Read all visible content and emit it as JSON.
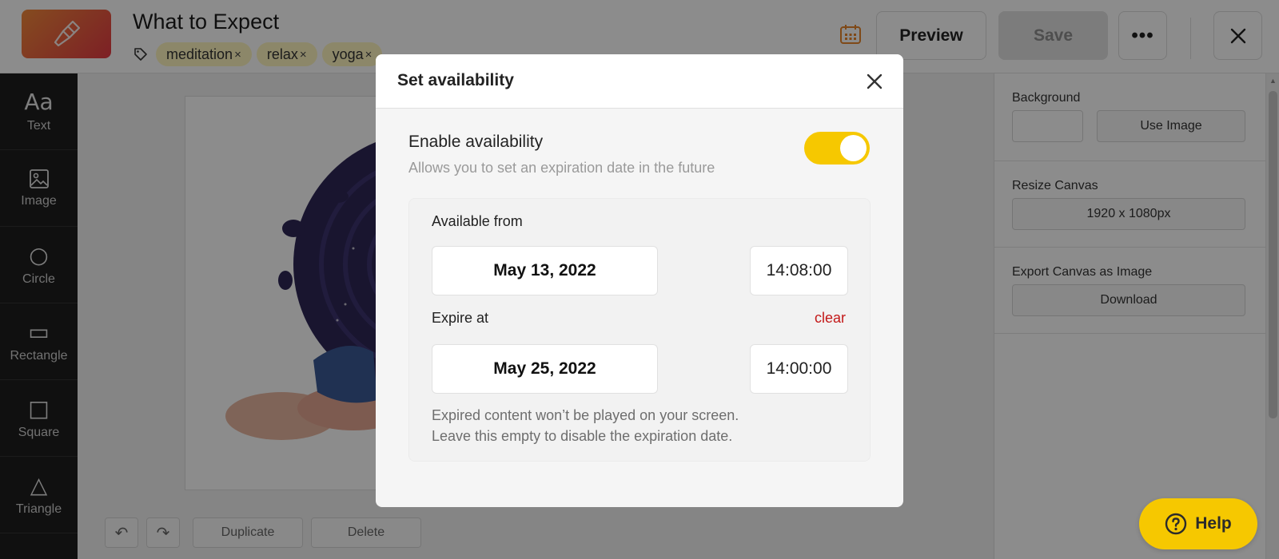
{
  "header": {
    "title": "What to Expect",
    "tags": [
      {
        "label": "meditation",
        "remove": "×"
      },
      {
        "label": "relax",
        "remove": "×"
      },
      {
        "label": "yoga",
        "remove": "×"
      }
    ],
    "preview_label": "Preview",
    "save_label": "Save",
    "more_label": "•••"
  },
  "tools": [
    {
      "label": "Text",
      "glyph": "Aa",
      "icon": "text-icon"
    },
    {
      "label": "Image",
      "glyph": "",
      "icon": "image-icon"
    },
    {
      "label": "Circle",
      "glyph": "○",
      "icon": "circle-icon"
    },
    {
      "label": "Rectangle",
      "glyph": "▭",
      "icon": "rectangle-icon"
    },
    {
      "label": "Square",
      "glyph": "□",
      "icon": "square-icon"
    },
    {
      "label": "Triangle",
      "glyph": "△",
      "icon": "triangle-icon"
    }
  ],
  "canvas_tools": {
    "undo": "↶",
    "redo": "↷",
    "duplicate_label": "Duplicate",
    "delete_label": "Delete"
  },
  "right_panel": {
    "background_label": "Background",
    "use_image_label": "Use Image",
    "resize_label": "Resize Canvas",
    "resize_value": "1920 x 1080px",
    "export_label": "Export Canvas as Image",
    "download_label": "Download"
  },
  "modal": {
    "title": "Set availability",
    "enable_label": "Enable availability",
    "enable_desc": "Allows you to set an expiration date in the future",
    "enabled": true,
    "available_from_label": "Available from",
    "from_date": "May 13, 2022",
    "from_time": "14:08:00",
    "expire_label": "Expire at",
    "clear_label": "clear",
    "expire_date": "May 25, 2022",
    "expire_time": "14:00:00",
    "note_line1": "Expired content won’t be played on your screen.",
    "note_line2": "Leave this empty to disable the expiration date."
  },
  "help_label": "Help",
  "colors": {
    "accent_yellow": "#f6c800",
    "clear_red": "#c31818",
    "toolbar_dark": "#1e1e1e"
  }
}
